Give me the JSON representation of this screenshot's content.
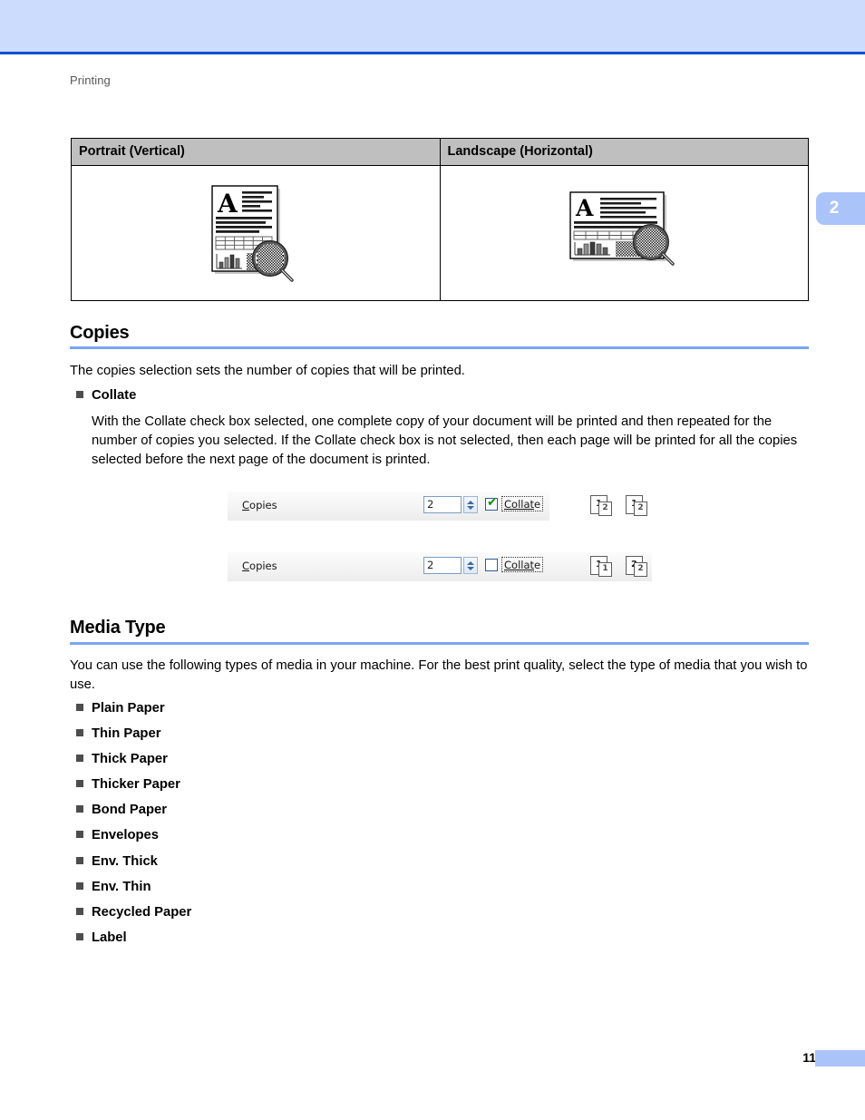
{
  "header": {
    "running_head": "Printing",
    "band_color": "#ccdcfc",
    "rule_color": "#0b4fd4"
  },
  "chapter_tab": {
    "number": "2",
    "color": "#aac4fa"
  },
  "orientation_table": {
    "columns": [
      "Portrait (Vertical)",
      "Landscape (Horizontal)"
    ],
    "header_bg": "#bfbfbf",
    "cells": [
      {
        "illustration": "portrait-document-with-magnifier-icon"
      },
      {
        "illustration": "landscape-document-with-magnifier-icon"
      }
    ]
  },
  "copies_section": {
    "heading": "Copies",
    "rule_color": "#7ba4f3",
    "intro": "The copies selection sets the number of copies that will be printed.",
    "subhead": "Collate",
    "description": "With the Collate check box selected, one complete copy of your document will be printed and then repeated for the number of copies you selected. If the Collate check box is not selected, then each page will be printed for all the copies selected before the next page of the document is printed.",
    "screenshots": [
      {
        "label": "Copies",
        "label_accel": "C",
        "label_rest": "opies",
        "value": "2",
        "checkbox_label": "Collate",
        "checkbox_accel": "Collat",
        "checkbox_accel_tail": "e",
        "checked": true,
        "check_glyph": "✔",
        "check_color": "#149414",
        "previews": [
          {
            "back": "1",
            "front": "2"
          },
          {
            "back": "1",
            "front": "2"
          }
        ]
      },
      {
        "label": "Copies",
        "label_accel": "C",
        "label_rest": "opies",
        "value": "2",
        "checkbox_label": "Collate",
        "checkbox_accel": "Collat",
        "checkbox_accel_tail": "e",
        "checked": false,
        "check_glyph": "",
        "check_color": "#149414",
        "previews": [
          {
            "back": "1",
            "front": "1"
          },
          {
            "back": "2",
            "front": "2"
          }
        ]
      }
    ]
  },
  "media_section": {
    "heading": "Media Type",
    "rule_color": "#7ba4f3",
    "intro": "You can use the following types of media in your machine. For the best print quality, select the type of media that you wish to use.",
    "items": [
      "Plain Paper",
      "Thin Paper",
      "Thick Paper",
      "Thicker Paper",
      "Bond Paper",
      "Envelopes",
      "Env. Thick",
      "Env. Thin",
      "Recycled Paper",
      "Label"
    ]
  },
  "footer": {
    "page_number": "11",
    "tab_color": "#aac4fa"
  }
}
